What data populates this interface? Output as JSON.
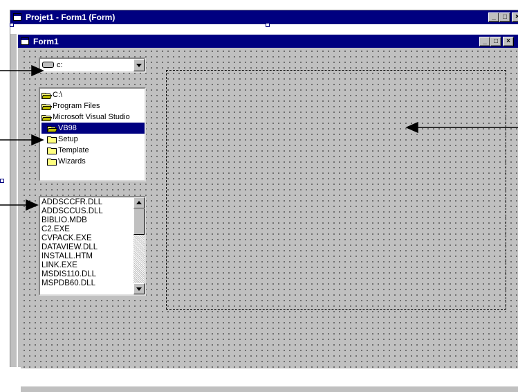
{
  "outer_window": {
    "title": "Projet1 - Form1 (Form)",
    "buttons": {
      "minimize": "_",
      "maximize": "□",
      "close": "×"
    }
  },
  "form_window": {
    "title": "Form1",
    "buttons": {
      "minimize": "_",
      "maximize": "□",
      "close": "×"
    }
  },
  "drive_list": {
    "selected": "c:",
    "icon": "drive-icon"
  },
  "dir_list": {
    "items": [
      {
        "label": "C:\\",
        "icon": "open-folder-icon",
        "selected": false
      },
      {
        "label": "Program Files",
        "icon": "open-folder-icon",
        "selected": false
      },
      {
        "label": "Microsoft Visual Studio",
        "icon": "open-folder-icon",
        "selected": false
      },
      {
        "label": "VB98",
        "icon": "open-folder-icon",
        "selected": true
      },
      {
        "label": "Setup",
        "icon": "folder-icon",
        "selected": false
      },
      {
        "label": "Template",
        "icon": "folder-icon",
        "selected": false
      },
      {
        "label": "Wizards",
        "icon": "folder-icon",
        "selected": false
      }
    ]
  },
  "file_list": {
    "items": [
      "ADDSCCFR.DLL",
      "ADDSCCUS.DLL",
      "BIBLIO.MDB",
      "C2.EXE",
      "CVPACK.EXE",
      "DATAVIEW.DLL",
      "INSTALL.HTM",
      "LINK.EXE",
      "MSDIS110.DLL",
      "MSPDB60.DLL"
    ]
  },
  "colors": {
    "title_bar": "#000080",
    "form_background": "#c0c0c0",
    "selection": "#000080",
    "folder": "#ffff80"
  }
}
